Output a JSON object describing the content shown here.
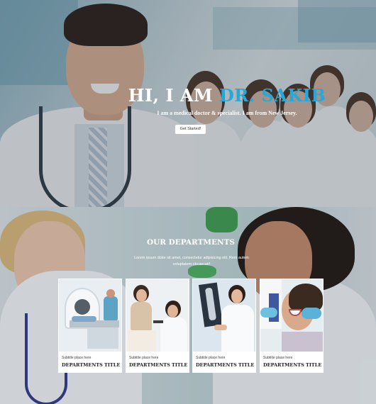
{
  "hero": {
    "title_part1": "HI, I AM ",
    "title_accent": "DR. SAKIB",
    "subtitle": "I am a medical doctor & specialist. I am from New Jersey.",
    "button_label": "Get Started!",
    "accent_color": "#29a7d8"
  },
  "departments": {
    "title": "OUR DEPARTMENTS",
    "text": "Lorem ipsum dolor sit amet, consectetur adipisicing elit. Rem autem voluptatem obcaecati!",
    "cards": [
      {
        "subtitle": "Subtitle place here",
        "title": "DEPARTMENTS TITLE",
        "image": "mri-scanner-photo"
      },
      {
        "subtitle": "Subtitle place here",
        "title": "DEPARTMENTS TITLE",
        "image": "doctor-examining-patient-photo"
      },
      {
        "subtitle": "Subtitle place here",
        "title": "DEPARTMENTS TITLE",
        "image": "doctor-viewing-xray-photo"
      },
      {
        "subtitle": "Subtitle place here",
        "title": "DEPARTMENTS TITLE",
        "image": "dental-checkup-photo"
      }
    ]
  }
}
